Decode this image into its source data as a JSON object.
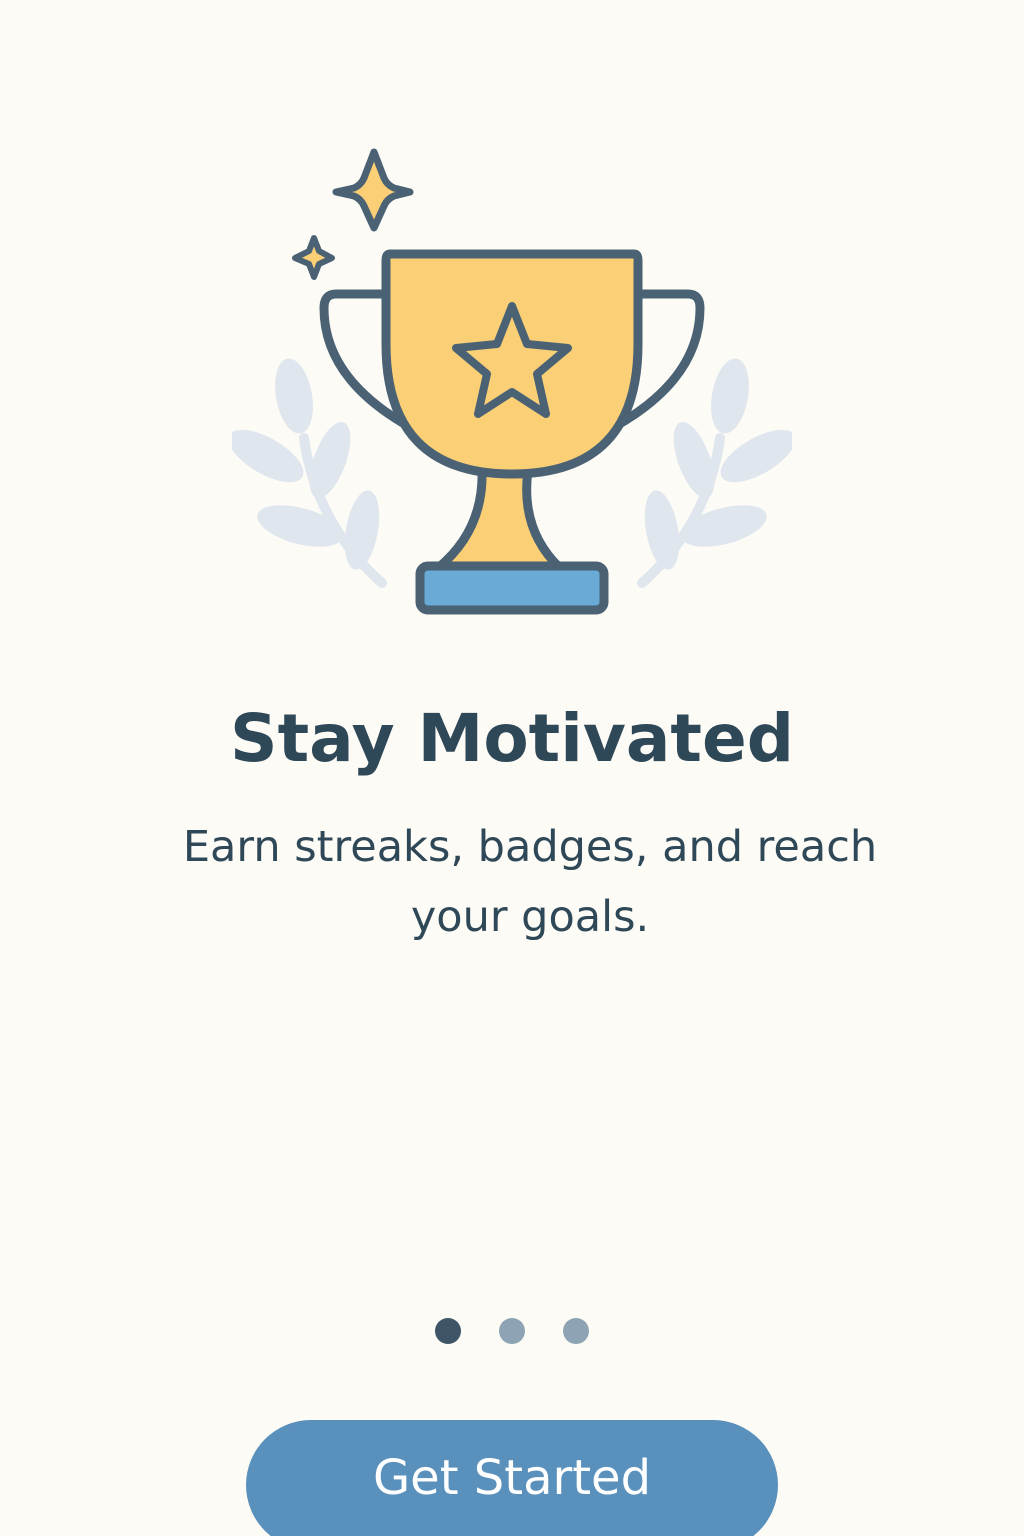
{
  "onboarding": {
    "title": "Stay Motivated",
    "subtitle": "Earn streaks, badges, and reach your goals.",
    "illustration_icon": "trophy-icon",
    "decor_icons": [
      "sparkle-icon",
      "laurel-icon"
    ],
    "pager": {
      "total": 3,
      "active_index": 0
    },
    "cta_label": "Get Started"
  },
  "colors": {
    "background": "#fdfbf6",
    "text": "#2f4858",
    "trophy_gold": "#fbcf75",
    "trophy_base": "#6aaad6",
    "outline": "#4a6274",
    "laurel": "#dfe6ee",
    "button": "#5a90bc",
    "dot_active": "#3d5566",
    "dot_inactive": "#8ea3b3"
  }
}
